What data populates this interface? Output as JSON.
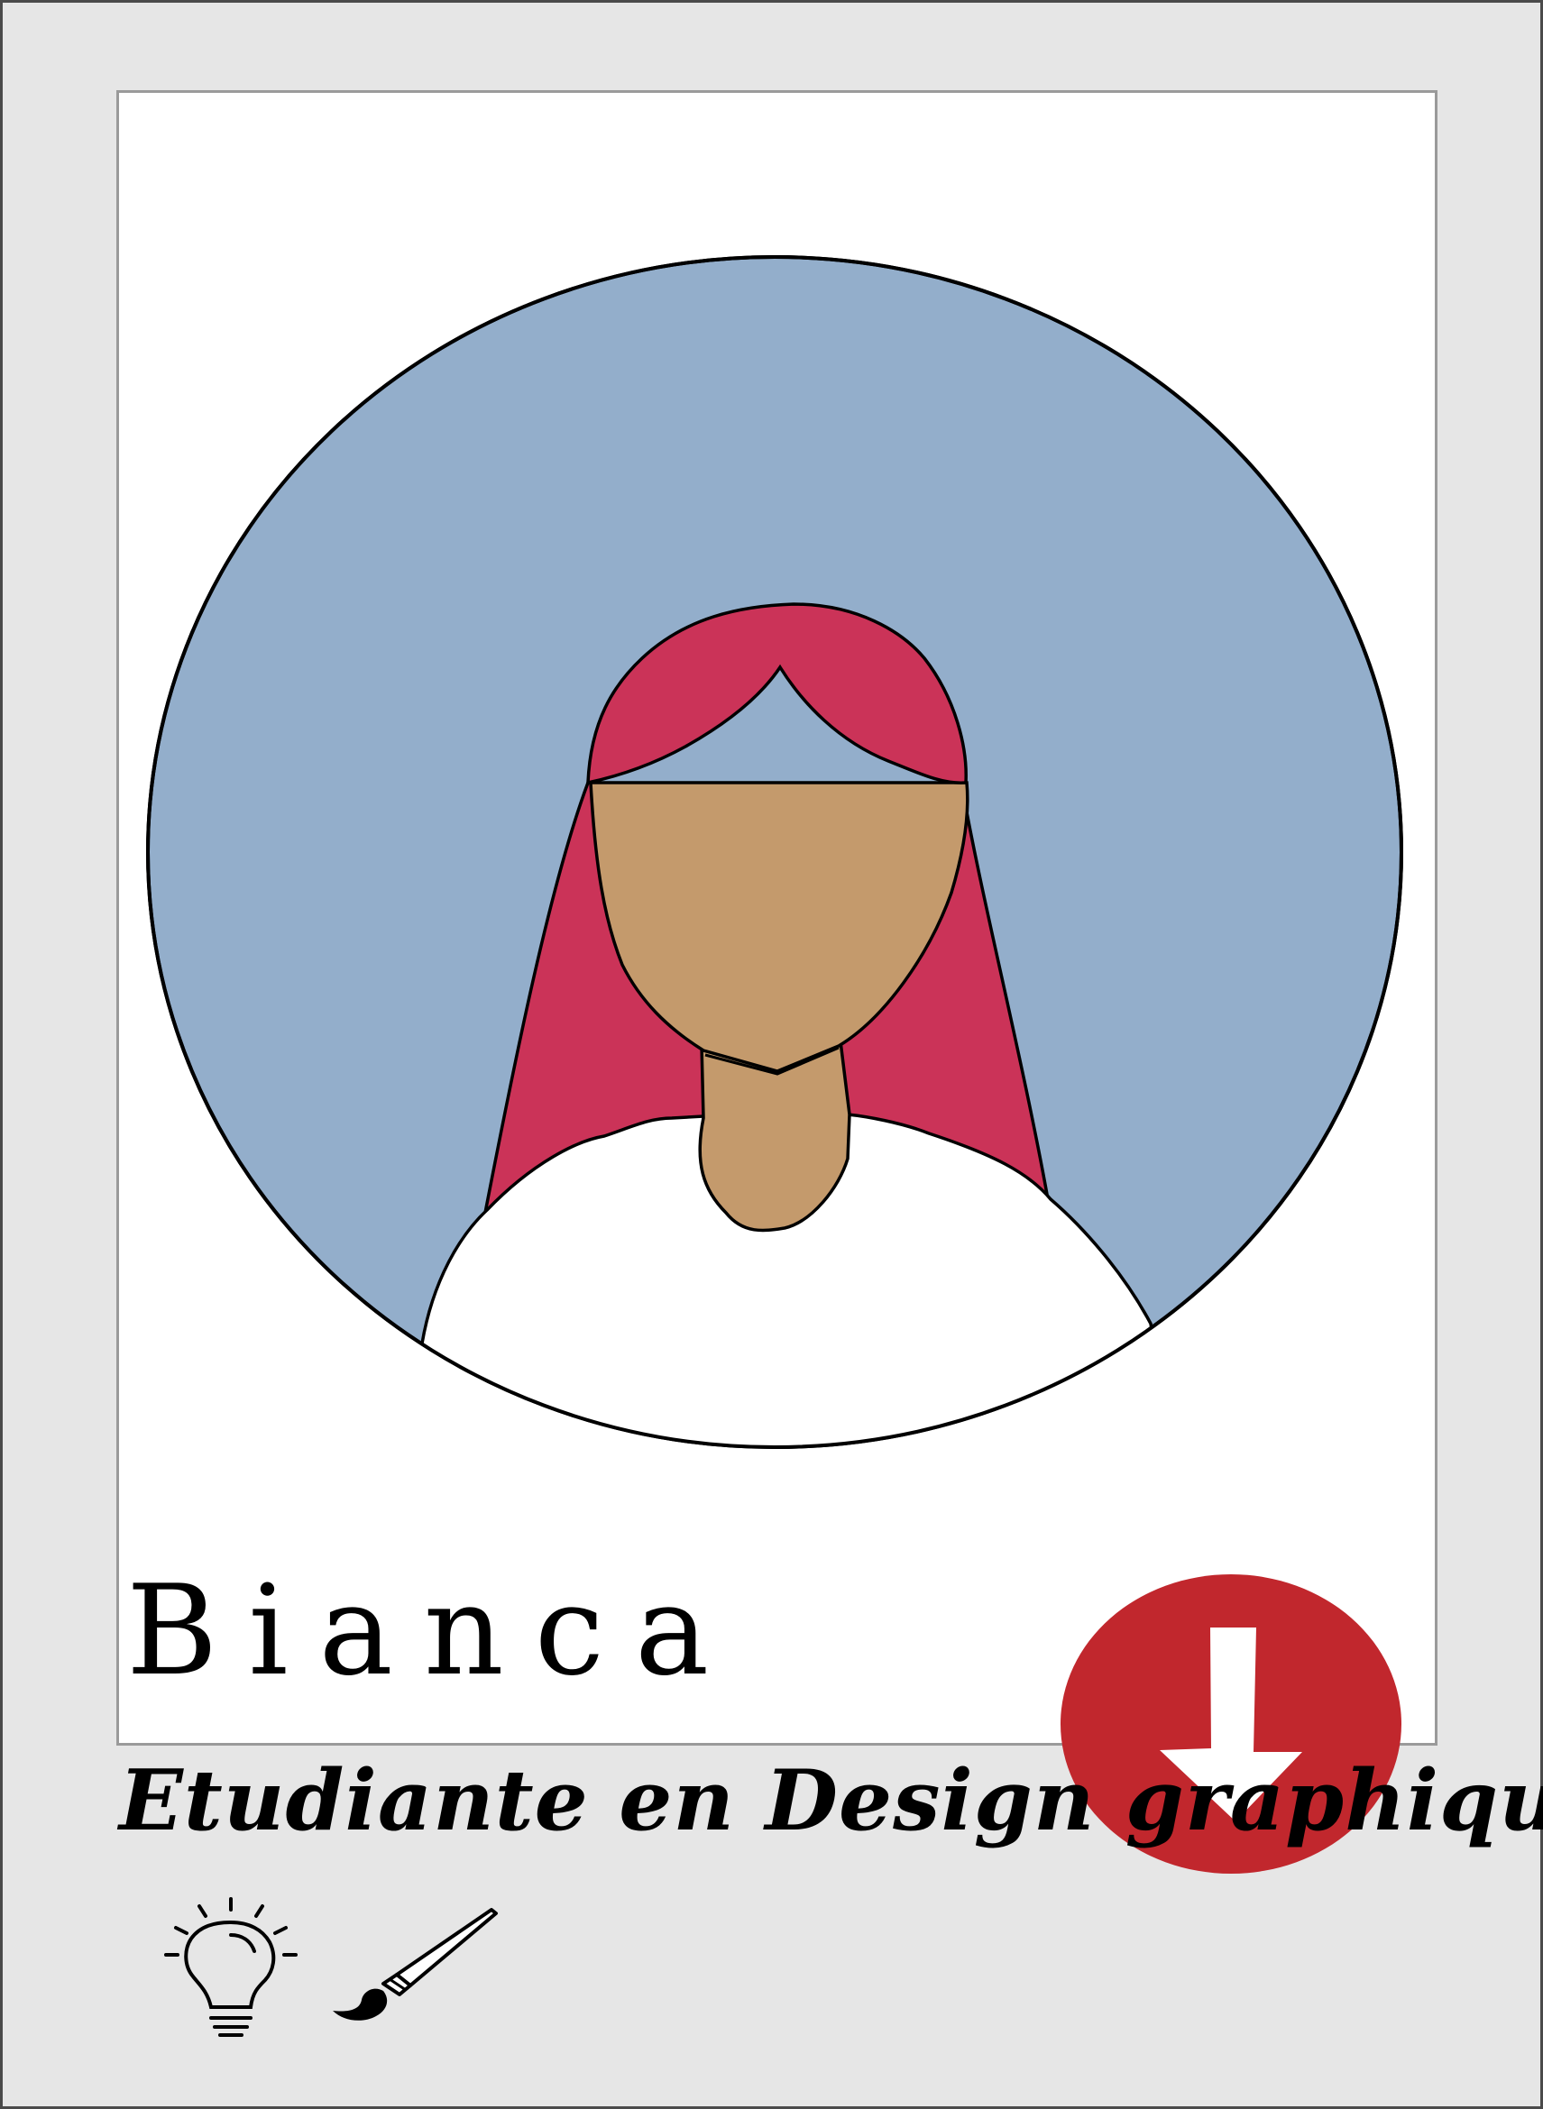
{
  "card": {
    "name": "Bianca",
    "role": "Etudiante en Design graphique"
  },
  "icons": {
    "download": "download-arrow-icon",
    "idea": "lightbulb-icon",
    "design": "paintbrush-icon"
  },
  "colors": {
    "background": "#e6e6e6",
    "card": "#ffffff",
    "portrait_background": "#93aecb",
    "hair": "#cb3358",
    "skin": "#c49a6c",
    "badge": "#c1272d"
  }
}
